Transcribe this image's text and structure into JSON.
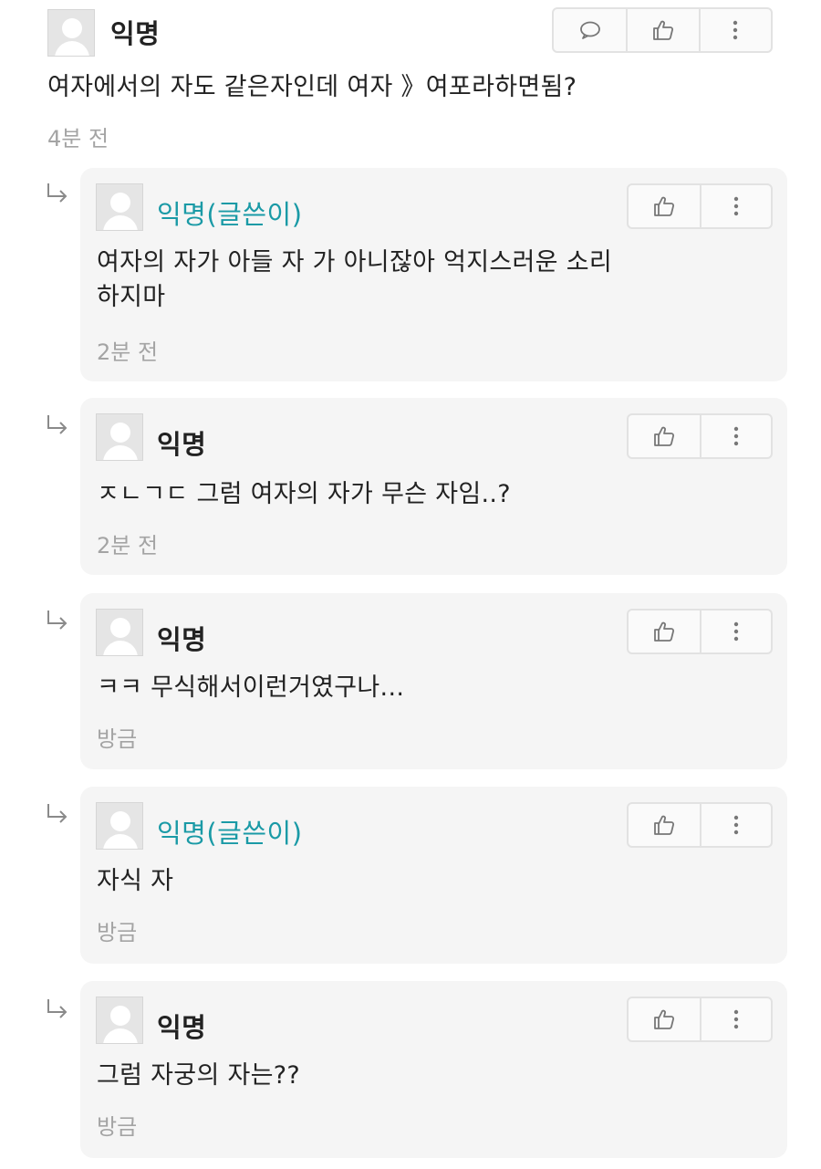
{
  "comments": [
    {
      "author": "익명",
      "text": "여자에서의 자도 같은자인데 여자 》여포라하면됨?",
      "time": "4분 전"
    },
    {
      "author": "익명(글쓴이)",
      "text_lines": [
        "여자의 자가 아들 자 가 아니잖아 억지스러운 소리",
        "하지마"
      ],
      "time": "2분 전"
    },
    {
      "author": "익명",
      "text": "ㅈㄴㄱㄷ 그럼 여자의 자가 무슨 자임..?",
      "time": "2분 전"
    },
    {
      "author": "익명",
      "text": "ㅋㅋ 무식해서이런거였구나...",
      "time": "방금"
    },
    {
      "author": "익명(글쓴이)",
      "text": "자식 자",
      "time": "방금"
    },
    {
      "author": "익명",
      "text": "그럼 자궁의 자는??",
      "time": "방금"
    }
  ],
  "icons": {
    "reply": "speech-bubble-icon",
    "like": "thumbs-up-icon",
    "more": "more-vertical-icon",
    "nested": "reply-arrow-icon",
    "avatar": "default-avatar"
  },
  "colors": {
    "author_name": "#1a9aa6",
    "card_background": "#f5f5f5",
    "time_text": "#a4a4a4"
  }
}
